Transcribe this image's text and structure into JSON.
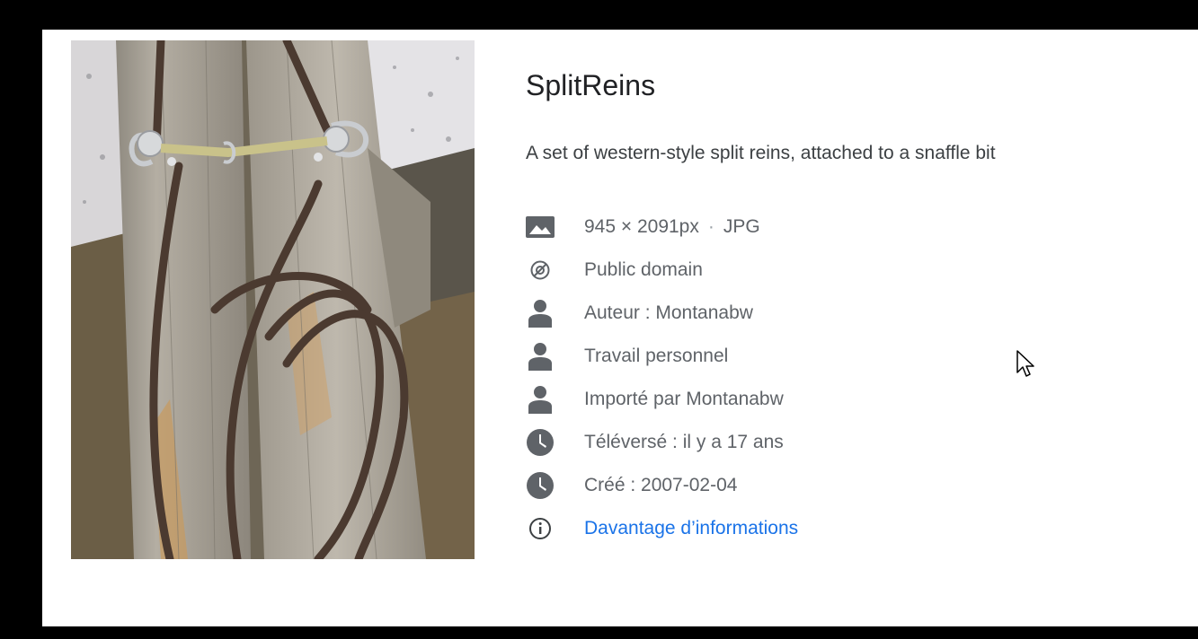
{
  "image": {
    "alt": "SplitReins"
  },
  "details": {
    "title": "SplitReins",
    "description": "A set of western-style split reins, attached to a snaffle bit",
    "dimensions": "945 × 2091px",
    "separator": "·",
    "format": "JPG",
    "license": "Public domain",
    "author": "Auteur : Montanabw",
    "work_type": "Travail personnel",
    "uploaded_by": "Importé par Montanabw",
    "uploaded": "Téléversé : il y a 17 ans",
    "created": "Créé : 2007-02-04",
    "more_info_link": "Davantage d’informations"
  },
  "icons": {
    "dimensions": "image-icon",
    "license": "public-domain-icon",
    "author": "person-icon",
    "work_type": "person-icon",
    "uploaded_by": "person-icon",
    "uploaded": "clock-icon",
    "created": "clock-icon",
    "more_info": "info-icon"
  },
  "colors": {
    "icon": "#5f6368",
    "link": "#1a73e8",
    "title": "#202124"
  }
}
